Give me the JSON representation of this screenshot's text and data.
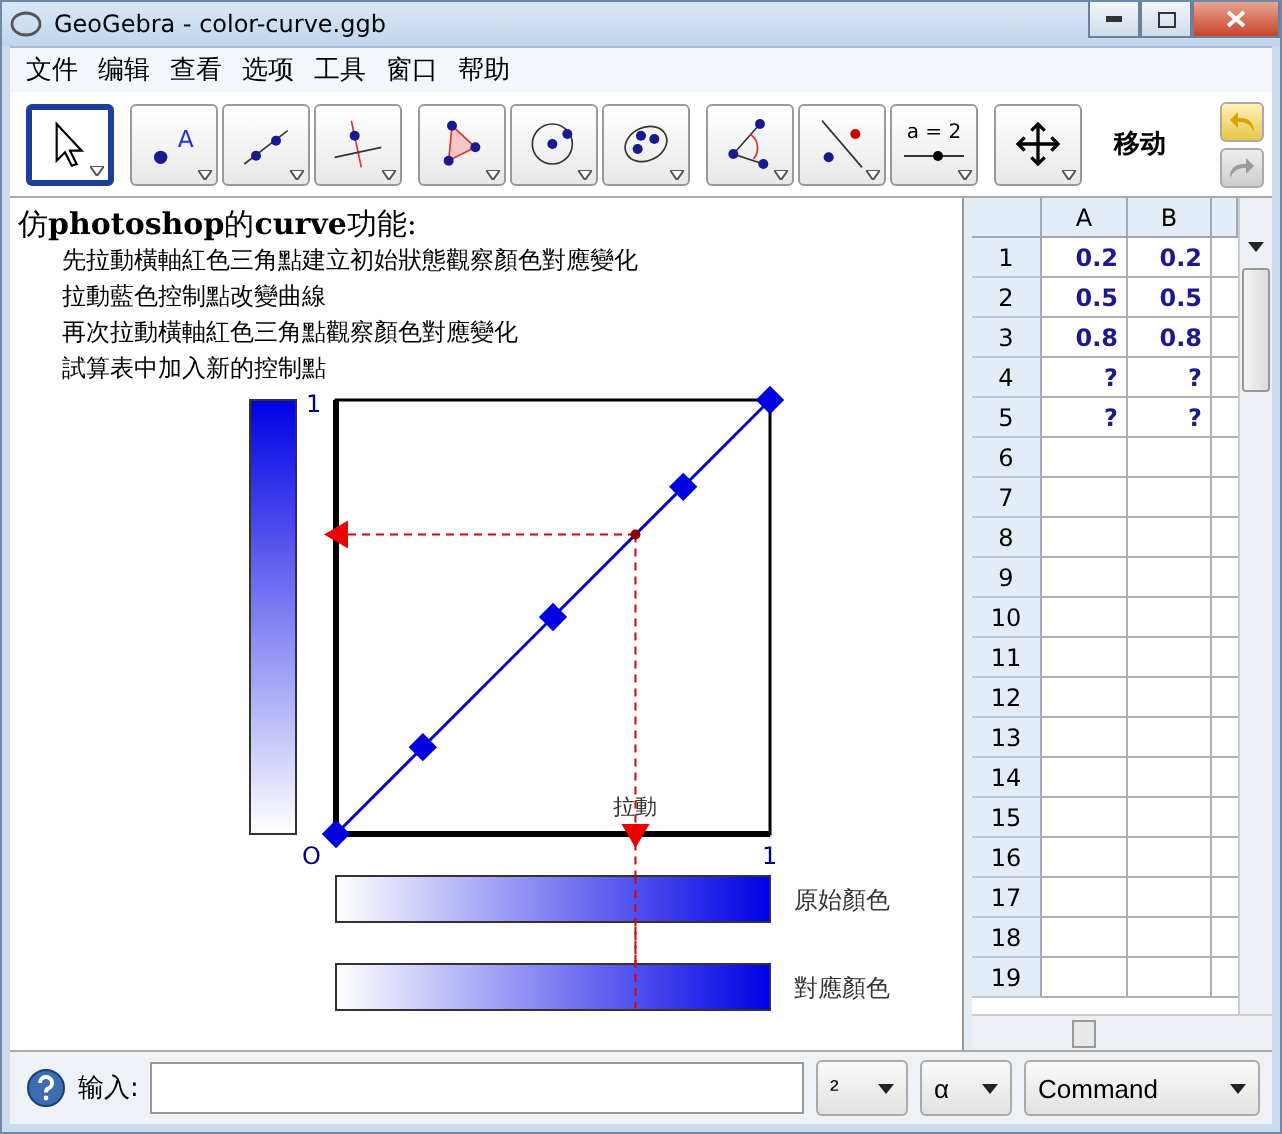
{
  "window": {
    "title": "GeoGebra - color-curve.ggb"
  },
  "menu": [
    "文件",
    "编辑",
    "查看",
    "选项",
    "工具",
    "窗口",
    "帮助"
  ],
  "toolbar": {
    "tools": [
      {
        "selected": true
      },
      {
        "selected": false,
        "text": "A"
      },
      {
        "selected": false
      },
      {
        "selected": false
      },
      {
        "selected": false
      },
      {
        "selected": false
      },
      {
        "selected": false
      },
      {
        "selected": false
      },
      {
        "selected": false
      },
      {
        "selected": false,
        "text": "a = 2"
      },
      {
        "selected": false
      }
    ],
    "tool_name": "移动"
  },
  "graphics": {
    "heading": "仿**photoshop**的**curve**功能:",
    "instructions": [
      "先拉動橫軸紅色三角點建立初始狀態觀察顏色對應變化",
      "拉動藍色控制點改變曲線",
      "再次拉動橫軸紅色三角點觀察顏色對應變化",
      "試算表中加入新的控制點"
    ],
    "axis_labels": {
      "y_max": "1",
      "origin": "O",
      "x_max": "1"
    },
    "marker": {
      "label": "拉動"
    },
    "bars": [
      "原始顏色",
      "對應顏色"
    ]
  },
  "spreadsheet": {
    "columns": [
      "A",
      "B"
    ],
    "rows": [
      {
        "label": "1",
        "cells": [
          "0.2",
          "0.2"
        ]
      },
      {
        "label": "2",
        "cells": [
          "0.5",
          "0.5"
        ]
      },
      {
        "label": "3",
        "cells": [
          "0.8",
          "0.8"
        ]
      },
      {
        "label": "4",
        "cells": [
          "?",
          "?"
        ]
      },
      {
        "label": "5",
        "cells": [
          "?",
          "?"
        ]
      },
      {
        "label": "6",
        "cells": []
      },
      {
        "label": "7",
        "cells": []
      },
      {
        "label": "8",
        "cells": []
      },
      {
        "label": "9",
        "cells": []
      },
      {
        "label": "10",
        "cells": []
      },
      {
        "label": "11",
        "cells": []
      },
      {
        "label": "12",
        "cells": []
      },
      {
        "label": "13",
        "cells": []
      },
      {
        "label": "14",
        "cells": []
      },
      {
        "label": "15",
        "cells": []
      },
      {
        "label": "16",
        "cells": []
      },
      {
        "label": "17",
        "cells": []
      },
      {
        "label": "18",
        "cells": []
      },
      {
        "label": "19",
        "cells": []
      }
    ]
  },
  "input_bar": {
    "label": "输入:",
    "dropdowns": [
      "²",
      "α",
      "Command"
    ]
  }
}
